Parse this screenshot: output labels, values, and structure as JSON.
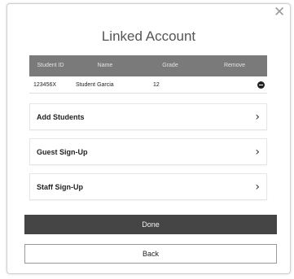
{
  "dialog": {
    "title": "Linked Account",
    "close_icon": "close-icon"
  },
  "table": {
    "headers": {
      "student_id": "Student ID",
      "name": "Name",
      "grade": "Grade",
      "remove": "Remove"
    },
    "rows": [
      {
        "student_id": "123456X",
        "name": "Student Garcia",
        "grade": "12",
        "remove_icon": "minus-circle-icon"
      }
    ]
  },
  "nav_items": [
    {
      "label": "Add Students",
      "icon": "chevron-right-icon"
    },
    {
      "label": "Guest Sign-Up",
      "icon": "chevron-right-icon"
    },
    {
      "label": "Staff Sign-Up",
      "icon": "chevron-right-icon"
    }
  ],
  "buttons": {
    "done": "Done",
    "back": "Back"
  },
  "colors": {
    "header_bg": "#7a7a7a",
    "done_bg": "#454545"
  }
}
